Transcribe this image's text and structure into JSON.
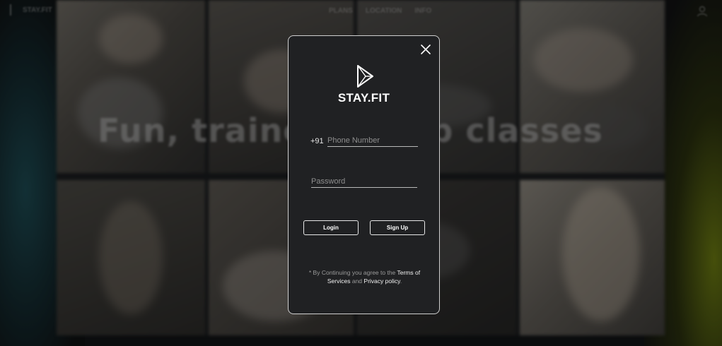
{
  "background": {
    "brand": "STAY.FIT",
    "nav_links": [
      "PLANS",
      "LOCATION",
      "INFO"
    ],
    "headline": "Fun, trained group classes",
    "accent_left": "#1d4a52",
    "accent_right": "#6b7a12"
  },
  "modal": {
    "brand": "STAY.FIT",
    "country_code": "+91",
    "phone_placeholder": "Phone Number",
    "password_placeholder": "Password",
    "login_label": "Login",
    "signup_label": "Sign Up",
    "terms_prefix": "* By Continuing you agree to the",
    "terms_link": "Terms of Services",
    "terms_and": "and",
    "privacy_link": "Privacy policy",
    "terms_suffix": ".",
    "icons": {
      "close": "close-icon",
      "logo": "stayfit-logo-icon"
    }
  },
  "colors": {
    "modal_bg": "#202123",
    "modal_border": "#cfcfcf",
    "text": "#ffffff"
  }
}
